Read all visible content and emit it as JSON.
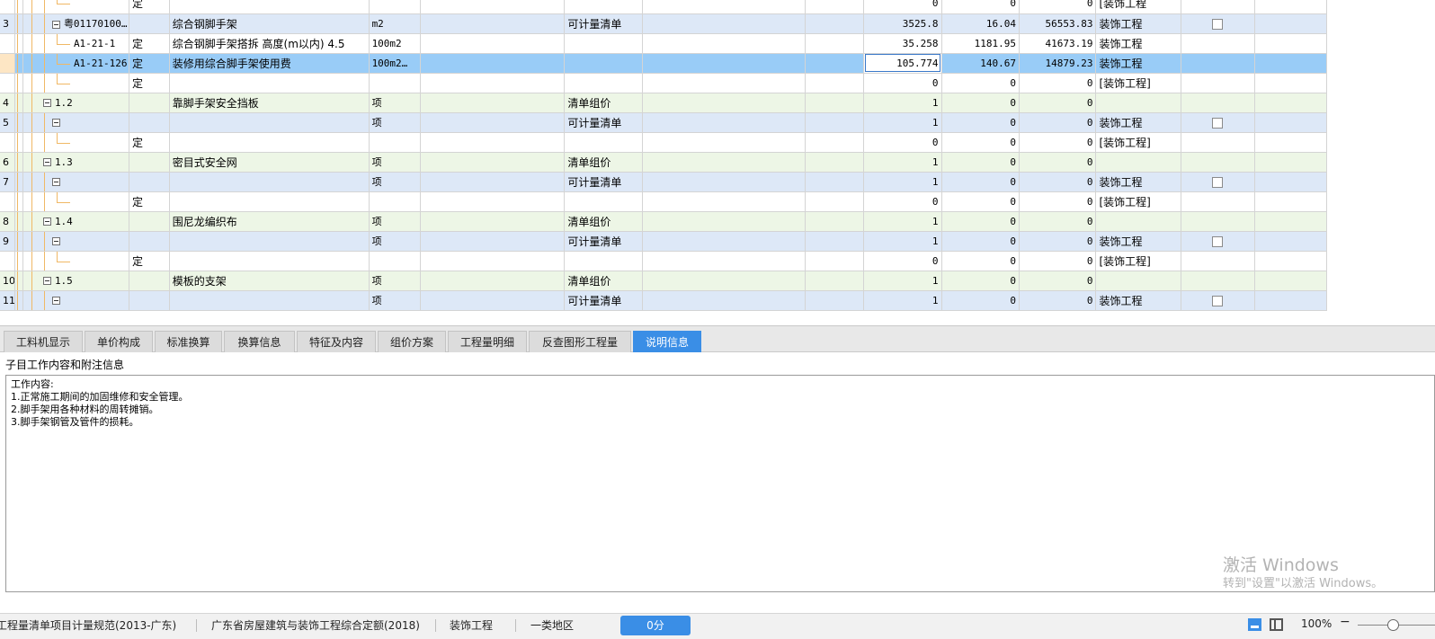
{
  "grid": {
    "rows": [
      {
        "no": "",
        "code": "",
        "type": "定",
        "name": "",
        "unit": "",
        "kind": "",
        "qty": "0",
        "price": "0",
        "total": "0",
        "prof": "[装饰工程",
        "check": false,
        "style": "white",
        "level": 3
      },
      {
        "no": "3",
        "code": "粤01170100…",
        "type": "",
        "name": "综合钢脚手架",
        "unit": "m2",
        "kind": "可计量清单",
        "qty": "3525.8",
        "price": "16.04",
        "total": "56553.83",
        "prof": "装饰工程",
        "check": true,
        "style": "blue",
        "level": 2
      },
      {
        "no": "",
        "code": "A1-21-1",
        "type": "定",
        "name": "综合钢脚手架搭拆 高度(m以内) 4.5",
        "unit": "100m2",
        "kind": "",
        "qty": "35.258",
        "price": "1181.95",
        "total": "41673.19",
        "prof": "装饰工程",
        "check": false,
        "style": "white",
        "level": 3
      },
      {
        "no": "",
        "code": "A1-21-126",
        "type": "定",
        "name": "装修用综合脚手架使用费",
        "unit": "100m2…",
        "kind": "",
        "qty": "105.774",
        "price": "140.67",
        "total": "14879.23",
        "prof": "装饰工程",
        "check": false,
        "style": "sel",
        "level": 3
      },
      {
        "no": "",
        "code": "",
        "type": "定",
        "name": "",
        "unit": "",
        "kind": "",
        "qty": "0",
        "price": "0",
        "total": "0",
        "prof": "[装饰工程]",
        "check": false,
        "style": "white",
        "level": 3
      },
      {
        "no": "4",
        "code": "1.2",
        "type": "",
        "name": "靠脚手架安全挡板",
        "unit": "项",
        "kind": "清单组价",
        "qty": "1",
        "price": "0",
        "total": "0",
        "prof": "",
        "check": false,
        "style": "green",
        "level": 1
      },
      {
        "no": "5",
        "code": "",
        "type": "",
        "name": "",
        "unit": "项",
        "kind": "可计量清单",
        "qty": "1",
        "price": "0",
        "total": "0",
        "prof": "装饰工程",
        "check": true,
        "style": "blue",
        "level": 2
      },
      {
        "no": "",
        "code": "",
        "type": "定",
        "name": "",
        "unit": "",
        "kind": "",
        "qty": "0",
        "price": "0",
        "total": "0",
        "prof": "[装饰工程]",
        "check": false,
        "style": "white",
        "level": 3
      },
      {
        "no": "6",
        "code": "1.3",
        "type": "",
        "name": "密目式安全网",
        "unit": "项",
        "kind": "清单组价",
        "qty": "1",
        "price": "0",
        "total": "0",
        "prof": "",
        "check": false,
        "style": "green",
        "level": 1
      },
      {
        "no": "7",
        "code": "",
        "type": "",
        "name": "",
        "unit": "项",
        "kind": "可计量清单",
        "qty": "1",
        "price": "0",
        "total": "0",
        "prof": "装饰工程",
        "check": true,
        "style": "blue",
        "level": 2
      },
      {
        "no": "",
        "code": "",
        "type": "定",
        "name": "",
        "unit": "",
        "kind": "",
        "qty": "0",
        "price": "0",
        "total": "0",
        "prof": "[装饰工程]",
        "check": false,
        "style": "white",
        "level": 3
      },
      {
        "no": "8",
        "code": "1.4",
        "type": "",
        "name": "围尼龙编织布",
        "unit": "项",
        "kind": "清单组价",
        "qty": "1",
        "price": "0",
        "total": "0",
        "prof": "",
        "check": false,
        "style": "green",
        "level": 1
      },
      {
        "no": "9",
        "code": "",
        "type": "",
        "name": "",
        "unit": "项",
        "kind": "可计量清单",
        "qty": "1",
        "price": "0",
        "total": "0",
        "prof": "装饰工程",
        "check": true,
        "style": "blue",
        "level": 2
      },
      {
        "no": "",
        "code": "",
        "type": "定",
        "name": "",
        "unit": "",
        "kind": "",
        "qty": "0",
        "price": "0",
        "total": "0",
        "prof": "[装饰工程]",
        "check": false,
        "style": "white",
        "level": 3
      },
      {
        "no": "10",
        "code": "1.5",
        "type": "",
        "name": "模板的支架",
        "unit": "项",
        "kind": "清单组价",
        "qty": "1",
        "price": "0",
        "total": "0",
        "prof": "",
        "check": false,
        "style": "green",
        "level": 1
      },
      {
        "no": "11",
        "code": "",
        "type": "",
        "name": "",
        "unit": "项",
        "kind": "可计量清单",
        "qty": "1",
        "price": "0",
        "total": "0",
        "prof": "装饰工程",
        "check": true,
        "style": "blue",
        "level": 2
      }
    ]
  },
  "tabs": [
    "工料机显示",
    "单价构成",
    "标准换算",
    "换算信息",
    "特征及内容",
    "组价方案",
    "工程量明细",
    "反查图形工程量",
    "说明信息"
  ],
  "active_tab": 8,
  "panel": {
    "title": "子目工作内容和附注信息",
    "lines": [
      "工作内容:",
      "1.正常施工期间的加固维修和安全管理。",
      "2.脚手架用各种材料的周转摊销。",
      "3.脚手架钢管及管件的损耗。"
    ]
  },
  "watermark": {
    "line1": "激活 Windows",
    "line2": "转到\"设置\"以激活 Windows。"
  },
  "status": {
    "spec": "工程量清单项目计量规范(2013-广东)",
    "quota": "广东省房屋建筑与装饰工程综合定额(2018)",
    "profession": "装饰工程",
    "region": "一类地区",
    "score": "0分",
    "zoom": "100%"
  },
  "colors": {
    "accent": "#3a8ee6",
    "selected_row": "#99ccf7",
    "green_row": "#edf6e6",
    "blue_row": "#dde8f7",
    "tree_line": "#f0b865"
  }
}
